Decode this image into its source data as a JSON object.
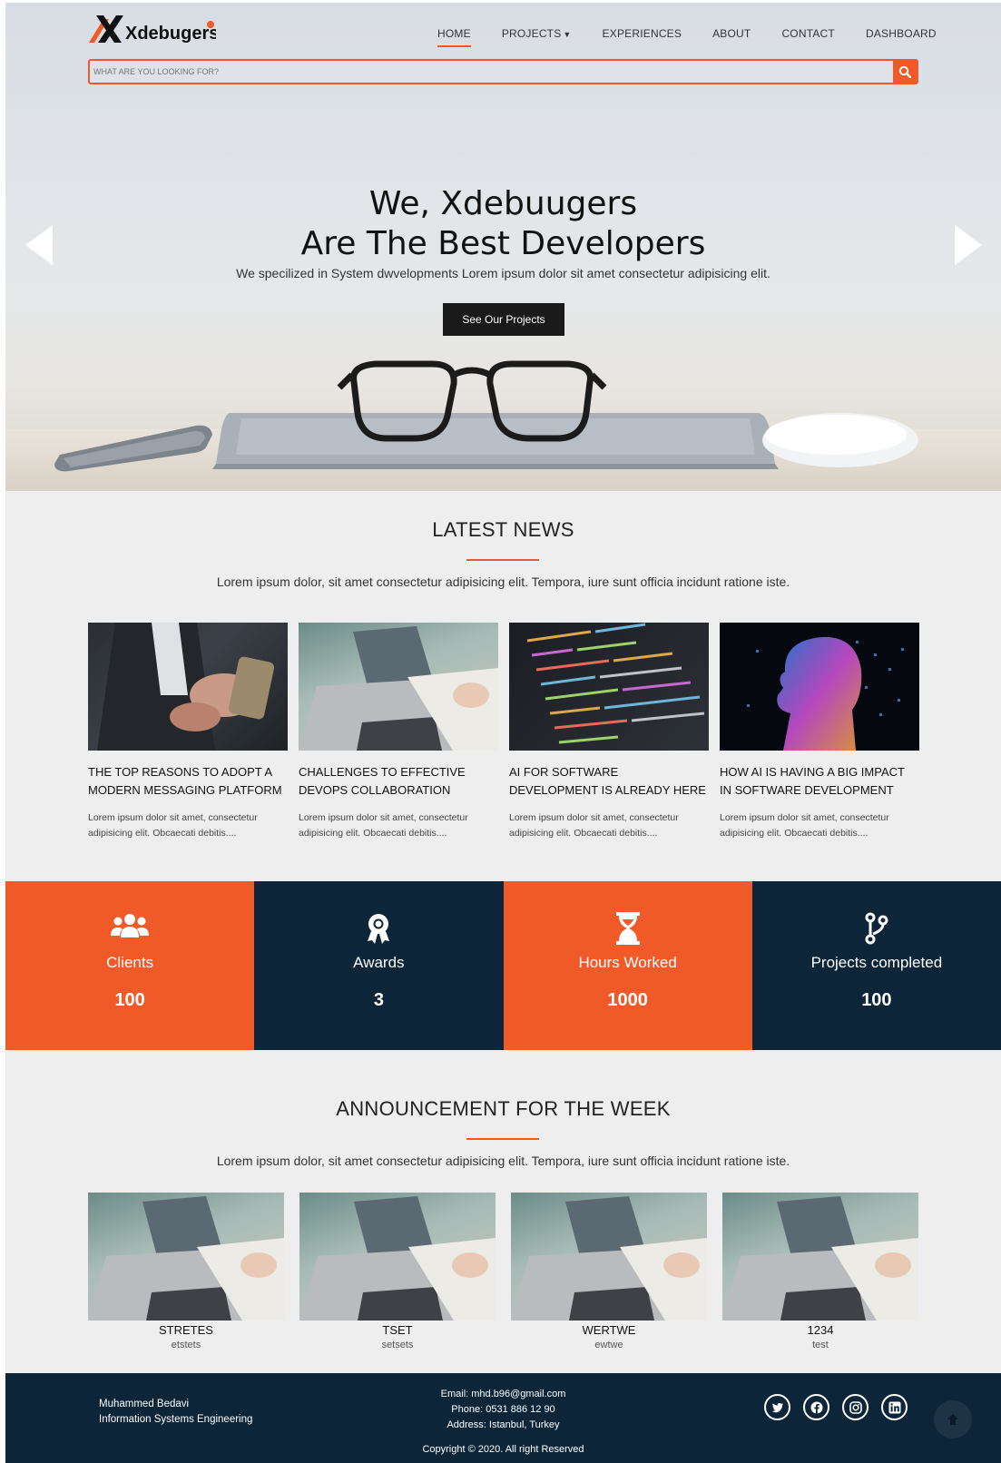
{
  "header": {
    "logo_text": "Xdebugers",
    "nav": [
      {
        "label": "HOME",
        "active": true
      },
      {
        "label": "PROJECTS",
        "has_dropdown": true
      },
      {
        "label": "EXPERIENCES"
      },
      {
        "label": "ABOUT"
      },
      {
        "label": "CONTACT"
      },
      {
        "label": "DASHBOARD"
      }
    ],
    "search_placeholder": "WHAT ARE YOU LOOKING FOR?"
  },
  "hero": {
    "title_line1": "We, Xdebuugers",
    "title_line2": "Are The Best Developers",
    "subtitle": "We specilized in System dwvelopments Lorem ipsum dolor sit amet consectetur adipisicing elit.",
    "button": "See Our Projects"
  },
  "news": {
    "title": "LATEST NEWS",
    "description": "Lorem ipsum dolor, sit amet consectetur adipisicing elit. Tempora, iure sunt officia incidunt ratione iste.",
    "items": [
      {
        "title": "THE TOP REASONS TO ADOPT A MODERN MESSAGING PLATFORM",
        "text": "Lorem ipsum dolor sit amet, consectetur adipisicing elit. Obcaecati debitis....",
        "image": "hand-phone-photo"
      },
      {
        "title": "CHALLENGES TO EFFECTIVE DEVOPS COLLABORATION",
        "text": "Lorem ipsum dolor sit amet, consectetur adipisicing elit. Obcaecati debitis....",
        "image": "laptop-desk-photo"
      },
      {
        "title": "AI FOR SOFTWARE DEVELOPMENT IS ALREADY HERE",
        "text": "Lorem ipsum dolor sit amet, consectetur adipisicing elit. Obcaecati debitis....",
        "image": "code-screen-photo"
      },
      {
        "title": "HOW AI IS HAVING A BIG IMPACT IN SOFTWARE DEVELOPMENT",
        "text": "Lorem ipsum dolor sit amet, consectetur adipisicing elit. Obcaecati debitis....",
        "image": "digital-head-photo"
      }
    ]
  },
  "stats": [
    {
      "label": "Clients",
      "value": "100",
      "icon": "users-icon",
      "color": "#f05a28"
    },
    {
      "label": "Awards",
      "value": "3",
      "icon": "award-icon",
      "color": "#0d2538"
    },
    {
      "label": "Hours Worked",
      "value": "1000",
      "icon": "hourglass-icon",
      "color": "#f05a28"
    },
    {
      "label": "Projects completed",
      "value": "100",
      "icon": "code-branch-icon",
      "color": "#0d2538"
    }
  ],
  "announcements": {
    "title": "ANNOUNCEMENT FOR THE WEEK",
    "description": "Lorem ipsum dolor, sit amet consectetur adipisicing elit. Tempora, iure sunt officia incidunt ratione iste.",
    "items": [
      {
        "title": "STRETES",
        "subtitle": "etstets"
      },
      {
        "title": "TSET",
        "subtitle": "setsets"
      },
      {
        "title": "WERTWE",
        "subtitle": "ewtwe"
      },
      {
        "title": "1234",
        "subtitle": "test"
      }
    ]
  },
  "footer": {
    "name": "Muhammed Bedavi",
    "role": "Information Systems Engineering",
    "email": "Email: mhd.b96@gmail.com",
    "phone": "Phone: 0531 886 12 90",
    "address": "Address: Istanbul, Turkey",
    "copyright": "Copyright © 2020. All right Reserved",
    "socials": [
      "twitter-icon",
      "facebook-icon",
      "instagram-icon",
      "linkedin-icon"
    ]
  },
  "colors": {
    "accent": "#f05a28",
    "navy": "#0d2538",
    "background": "#eeeeee"
  }
}
